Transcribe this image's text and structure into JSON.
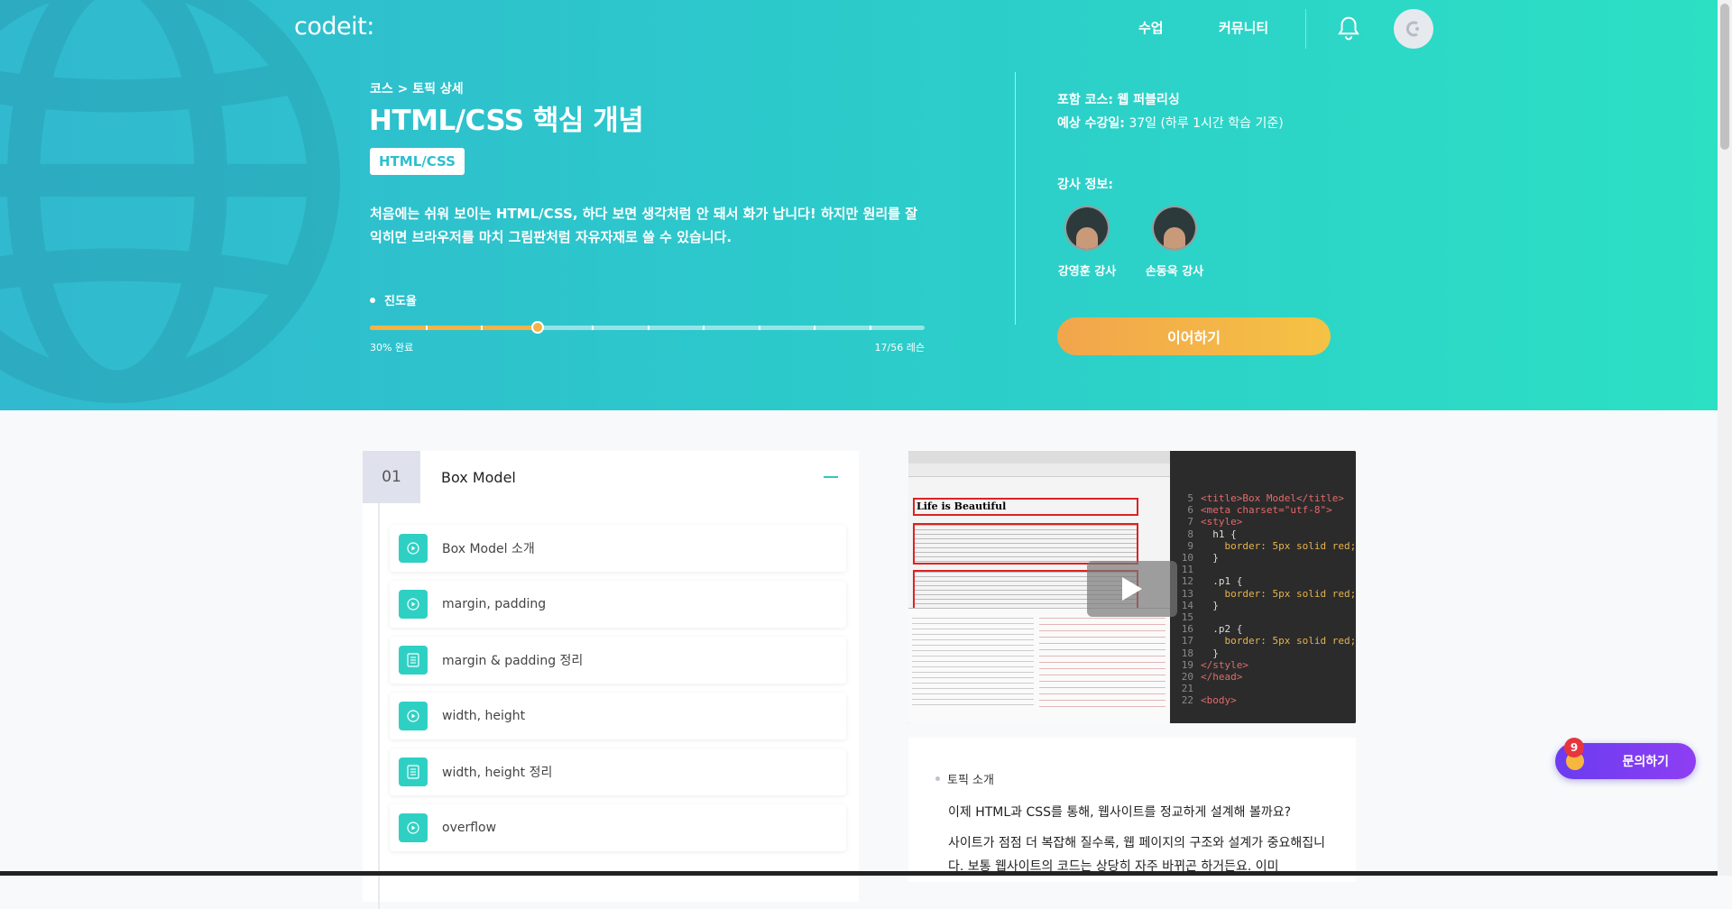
{
  "header": {
    "logo": "codeit:",
    "nav": [
      "수업",
      "커뮤니티"
    ]
  },
  "topic": {
    "breadcrumb": "코스 > 토픽 상세",
    "title": "HTML/CSS 핵심 개념",
    "tag": "HTML/CSS",
    "description": "처음에는 쉬워 보이는 HTML/CSS, 하다 보면 생각처럼 안 돼서 화가 납니다! 하지만 원리를 잘 익히면 브라우저를 마치 그림판처럼 자유자재로 쓸 수 있습니다."
  },
  "progress": {
    "label": "진도율",
    "percent_text": "30% 완료",
    "lessons_text": "17/56 레슨",
    "fraction": 0.3
  },
  "course_info": {
    "course_label": "포함 코스:",
    "course_value": "웹 퍼블리싱",
    "duration_label": "예상 수강일:",
    "duration_value": "37일 (하루 1시간 학습 기준)",
    "instructors_label": "강사 정보:",
    "instructors": [
      "강영훈 강사",
      "손동욱 강사"
    ],
    "continue_label": "이어하기"
  },
  "chapter": {
    "number": "01",
    "title": "Box Model",
    "lessons": [
      {
        "label": "Box Model 소개",
        "type": "video"
      },
      {
        "label": "margin, padding",
        "type": "video"
      },
      {
        "label": "margin & padding 정리",
        "type": "note"
      },
      {
        "label": "width, height",
        "type": "video"
      },
      {
        "label": "width, height 정리",
        "type": "note"
      },
      {
        "label": "overflow",
        "type": "video"
      }
    ]
  },
  "video": {
    "heading_text": "Life is Beautiful",
    "code_lines": [
      {
        "n": "5",
        "code": "<title>Box Model</title>"
      },
      {
        "n": "6",
        "code": "<meta charset=\"utf-8\">"
      },
      {
        "n": "7",
        "code": "<style>"
      },
      {
        "n": "8",
        "code": "  h1 {"
      },
      {
        "n": "9",
        "code": "    border: 5px solid red;"
      },
      {
        "n": "10",
        "code": "  }"
      },
      {
        "n": "11",
        "code": ""
      },
      {
        "n": "12",
        "code": "  .p1 {"
      },
      {
        "n": "13",
        "code": "    border: 5px solid red;"
      },
      {
        "n": "14",
        "code": "  }"
      },
      {
        "n": "15",
        "code": ""
      },
      {
        "n": "16",
        "code": "  .p2 {"
      },
      {
        "n": "17",
        "code": "    border: 5px solid red;"
      },
      {
        "n": "18",
        "code": "  }"
      },
      {
        "n": "19",
        "code": "</style>"
      },
      {
        "n": "20",
        "code": "</head>"
      },
      {
        "n": "21",
        "code": ""
      },
      {
        "n": "22",
        "code": "<body>"
      }
    ]
  },
  "intro": {
    "heading": "토픽 소개",
    "line1": "이제 HTML과 CSS를 통해, 웹사이트를 정교하게 설계해 볼까요?",
    "line2": "사이트가 점점 더 복잡해 질수록, 웹 페이지의 구조와 설계가 중요해집니다. 보통 웹사이트의 코드는 상당히 자주 바뀌곤 하거든요. 이미"
  },
  "help": {
    "label": "문의하기",
    "badge": "9"
  },
  "colors": {
    "accent": "#2dc8c2",
    "progress": "#f2b347",
    "continue_start": "#f2a54c",
    "continue_end": "#f5c244",
    "help": "#7a3df1"
  }
}
